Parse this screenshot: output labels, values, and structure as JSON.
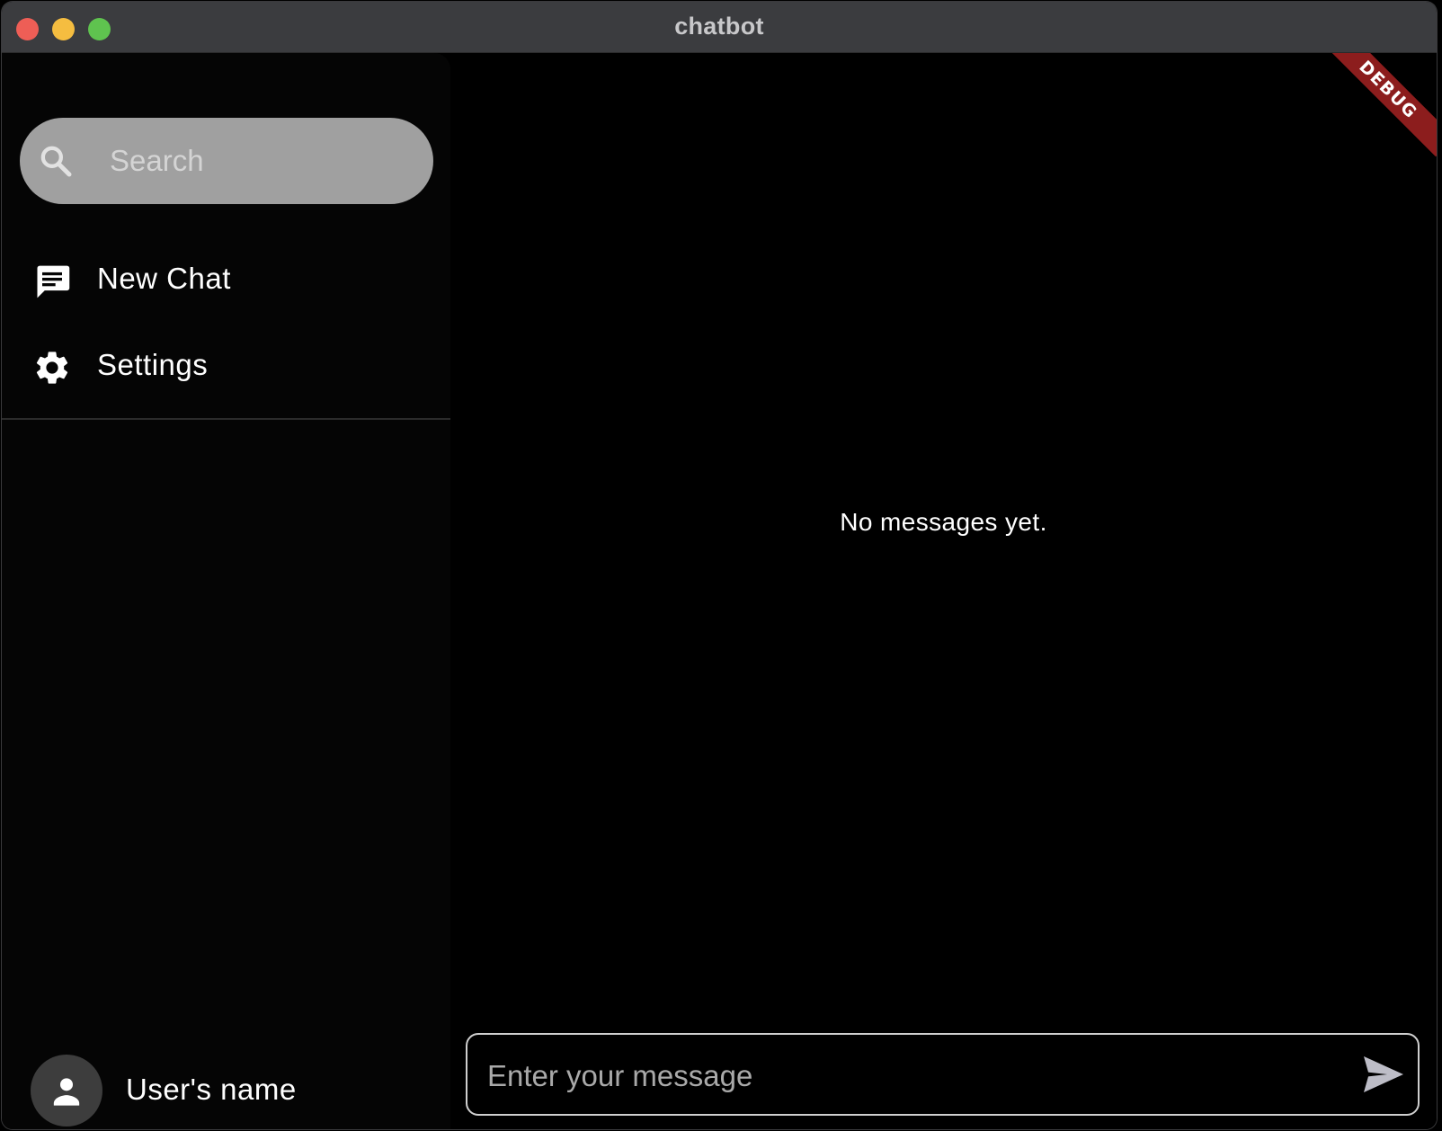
{
  "window": {
    "title": "chatbot"
  },
  "sidebar": {
    "search": {
      "placeholder": "Search",
      "value": ""
    },
    "items": [
      {
        "label": "New Chat",
        "icon": "chat-icon"
      },
      {
        "label": "Settings",
        "icon": "gear-icon"
      }
    ],
    "user": {
      "name": "User's name",
      "icon": "person-icon"
    }
  },
  "main": {
    "empty_state": "No messages yet.",
    "composer": {
      "placeholder": "Enter your message",
      "value": "",
      "send_icon": "send-icon"
    },
    "debug_banner": "DEBUG"
  },
  "colors": {
    "titlebar": "#3b3c3f",
    "sidebar_bg": "#050505",
    "main_bg": "#000000",
    "search_bg": "#a0a0a0",
    "debug_banner": "#8c1d1d",
    "close": "#ee5e56",
    "minimize": "#f5bd40",
    "maximize": "#5fc34f"
  }
}
